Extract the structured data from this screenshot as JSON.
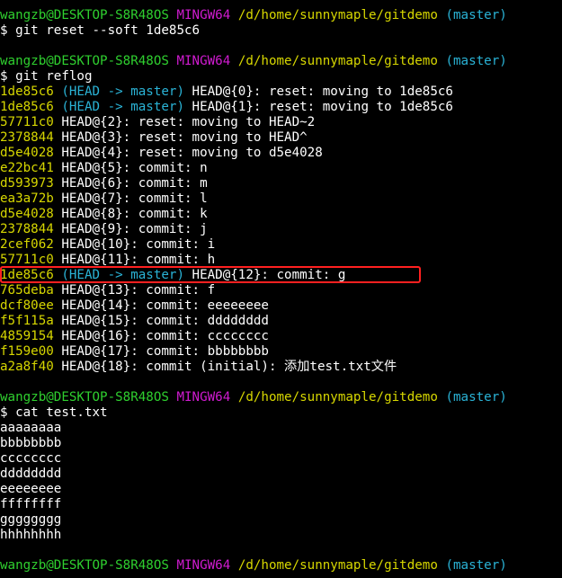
{
  "terminal": {
    "prompt": {
      "user_host": "wangzb@DESKTOP-S8R48OS",
      "shell": "MINGW64",
      "path": "/d/home/sunnymaple/gitdemo",
      "branch": "(master)"
    },
    "commands": {
      "reset": "$ git reset --soft 1de85c6",
      "reflog": "$ git reflog",
      "cat": "$ cat test.txt"
    },
    "reflog": [
      {
        "hash": "1de85c6",
        "ref": "(HEAD -> master)",
        "text": " HEAD@{0}: reset: moving to 1de85c6"
      },
      {
        "hash": "1de85c6",
        "ref": "(HEAD -> master)",
        "text": " HEAD@{1}: reset: moving to 1de85c6"
      },
      {
        "hash": "57711c0",
        "ref": "",
        "text": " HEAD@{2}: reset: moving to HEAD~2"
      },
      {
        "hash": "2378844",
        "ref": "",
        "text": " HEAD@{3}: reset: moving to HEAD^"
      },
      {
        "hash": "d5e4028",
        "ref": "",
        "text": " HEAD@{4}: reset: moving to d5e4028"
      },
      {
        "hash": "e22bc41",
        "ref": "",
        "text": " HEAD@{5}: commit: n"
      },
      {
        "hash": "d593973",
        "ref": "",
        "text": " HEAD@{6}: commit: m"
      },
      {
        "hash": "ea3a72b",
        "ref": "",
        "text": " HEAD@{7}: commit: l"
      },
      {
        "hash": "d5e4028",
        "ref": "",
        "text": " HEAD@{8}: commit: k"
      },
      {
        "hash": "2378844",
        "ref": "",
        "text": " HEAD@{9}: commit: j"
      },
      {
        "hash": "2cef062",
        "ref": "",
        "text": " HEAD@{10}: commit: i"
      },
      {
        "hash": "57711c0",
        "ref": "",
        "text": " HEAD@{11}: commit: h"
      },
      {
        "hash": "1de85c6",
        "ref": "(HEAD -> master)",
        "text": " HEAD@{12}: commit: g"
      },
      {
        "hash": "765deba",
        "ref": "",
        "text": " HEAD@{13}: commit: f"
      },
      {
        "hash": "dcf80ee",
        "ref": "",
        "text": " HEAD@{14}: commit: eeeeeeee"
      },
      {
        "hash": "f5f115a",
        "ref": "",
        "text": " HEAD@{15}: commit: dddddddd"
      },
      {
        "hash": "4859154",
        "ref": "",
        "text": " HEAD@{16}: commit: cccccccc"
      },
      {
        "hash": "f159e00",
        "ref": "",
        "text": " HEAD@{17}: commit: bbbbbbbb"
      },
      {
        "hash": "a2a8f40",
        "ref": "",
        "text": " HEAD@{18}: commit (initial): 添加test.txt文件"
      }
    ],
    "file_lines": [
      "aaaaaaaa",
      "bbbbbbbb",
      "cccccccc",
      "dddddddd",
      "eeeeeeee",
      "ffffffff",
      "gggggggg",
      "hhhhhhhh"
    ]
  },
  "colors": {
    "background": "#000000",
    "user_host": "#2fd02f",
    "shell": "#d01bd0",
    "path_and_hash": "#d7d700",
    "branch_and_ref": "#2ab3d6",
    "highlight_border": "#ff2020"
  }
}
